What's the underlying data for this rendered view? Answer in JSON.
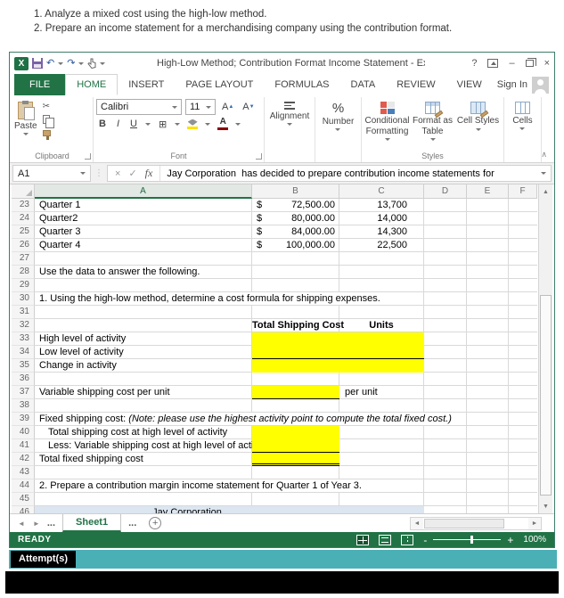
{
  "instructions": {
    "line1": "1. Analyze a mixed cost using the high-low method.",
    "line2": "2. Prepare an income statement for a merchandising company using the contribution format."
  },
  "titlebar": {
    "title": "High-Low Method; Contribution Format Income Statement - Excel",
    "sign_in": "Sign In"
  },
  "icons": {
    "excel_logo": "X",
    "undo": "↶",
    "redo": "↷",
    "help": "?",
    "minimize": "–",
    "close": "×",
    "cut": "✂",
    "borders": "⊞",
    "bold": "B",
    "italic": "I",
    "underline": "U",
    "grow_font": "A",
    "shrink_font": "A",
    "font_color_letter": "A",
    "percent": "%",
    "cancel": "×",
    "enter": "✓",
    "fx": "fx",
    "collapse_ribbon": "∧",
    "vertical_dots": "⋮",
    "scroll_up": "▲",
    "scroll_down": "▼",
    "sheet_prev": "◄",
    "sheet_next": "►",
    "hscroll_left": "◄",
    "hscroll_right": "►",
    "add_sheet": "+",
    "zoom_out": "-",
    "zoom_in": "+"
  },
  "tabs": {
    "file": "FILE",
    "items": [
      "HOME",
      "INSERT",
      "PAGE LAYOUT",
      "FORMULAS",
      "DATA",
      "REVIEW",
      "VIEW"
    ],
    "active": "HOME"
  },
  "ribbon": {
    "paste": "Paste",
    "font_name": "Calibri",
    "font_size": "11",
    "alignment": "Alignment",
    "number": "Number",
    "conditional_formatting": "Conditional Formatting",
    "format_as_table": "Format as Table",
    "cell_styles": "Cell Styles",
    "cells": "Cells",
    "group_clipboard": "Clipboard",
    "group_font": "Font",
    "group_styles": "Styles",
    "accent_yellow": "#ffe100",
    "accent_font_color": "#8b0000"
  },
  "formula_bar": {
    "cell_ref": "A1",
    "value": "Jay Corporation  has decided to prepare contribution income statements for"
  },
  "grid": {
    "column_headers": [
      "A",
      "B",
      "C",
      "D",
      "E",
      "F"
    ],
    "active_column": "A",
    "fill_color": "#ffff00",
    "merged_fill_color": "#dce6f1",
    "rows": [
      {
        "n": "23",
        "a": "Quarter 1",
        "b_prefix": "$",
        "b": "72,500.00",
        "c": "13,700",
        "c_align": "right"
      },
      {
        "n": "24",
        "a": "Quarter2",
        "b_prefix": "$",
        "b": "80,000.00",
        "c": "14,000",
        "c_align": "right"
      },
      {
        "n": "25",
        "a": "Quarter 3",
        "b_prefix": "$",
        "b": "84,000.00",
        "c": "14,300",
        "c_align": "right"
      },
      {
        "n": "26",
        "a": "Quarter 4",
        "b_prefix": "$",
        "b": "100,000.00",
        "c": "22,500",
        "c_align": "right"
      },
      {
        "n": "27"
      },
      {
        "n": "28",
        "a": "Use the data to answer the following."
      },
      {
        "n": "29"
      },
      {
        "n": "30",
        "long": "1. Using the high-low method, determine a cost formula for shipping expenses.",
        "span_cols": 3
      },
      {
        "n": "31"
      },
      {
        "n": "32",
        "b": "Total Shipping Cost",
        "b_align": "center",
        "c": "Units",
        "c_align": "center"
      },
      {
        "n": "33",
        "a": "High level of activity",
        "b_fill": true,
        "c_fill": true
      },
      {
        "n": "34",
        "a": "Low level of activity",
        "b_fill": true,
        "c_fill": true,
        "b_border": "single",
        "c_border": "single"
      },
      {
        "n": "35",
        "a": "Change in activity",
        "b_fill": true,
        "c_fill": true
      },
      {
        "n": "36"
      },
      {
        "n": "37",
        "a": "Variable shipping cost per unit",
        "b_fill": true,
        "b_border": "single",
        "c": "per unit",
        "c_align": "left"
      },
      {
        "n": "38"
      },
      {
        "n": "39",
        "long": "Fixed shipping cost:",
        "long_note": " (Note: please use the highest activity point to compute the total fixed cost.)",
        "span_cols": 4
      },
      {
        "n": "40",
        "a": "Total shipping cost at high level of activity",
        "indent": true,
        "b_fill": true
      },
      {
        "n": "41",
        "a": "Less: Variable shipping cost at high level of activity",
        "indent": true,
        "b_fill": true,
        "b_border": "single"
      },
      {
        "n": "42",
        "a": "Total fixed shipping cost",
        "b_fill": true,
        "b_border": "double"
      },
      {
        "n": "43"
      },
      {
        "n": "44",
        "long": "2. Prepare a contribution margin income statement for Quarter 1 of Year 3.",
        "span_cols": 3
      },
      {
        "n": "45"
      },
      {
        "n": "46",
        "merged_text": "Jay Corporation"
      }
    ]
  },
  "sheet_bar": {
    "dots_left": "...",
    "sheet_name": "Sheet1",
    "dots_right": "..."
  },
  "status_bar": {
    "mode": "READY",
    "zoom_level": "100%"
  },
  "attempts_label": "Attempt(s)"
}
